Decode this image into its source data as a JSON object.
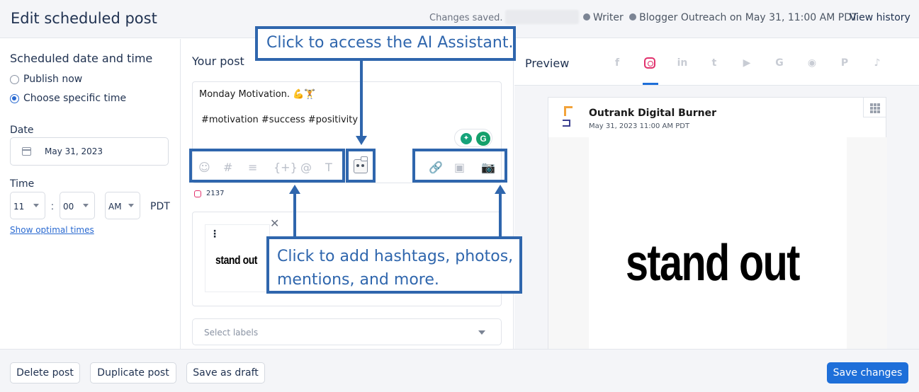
{
  "header": {
    "title": "Edit scheduled post",
    "changes_saved": "Changes saved.",
    "meta_suffix_1": "Writer",
    "meta_suffix_2": "Blogger Outreach on May 31, 11:00 AM PDT",
    "view_history": "View history"
  },
  "schedule": {
    "title": "Scheduled date and time",
    "options": [
      "Publish now",
      "Choose specific time"
    ],
    "selected": "Choose specific time",
    "date_label": "Date",
    "date_value": "May 31, 2023",
    "time_label": "Time",
    "hour": "11",
    "minute": "00",
    "ampm": "AM",
    "timezone": "PDT",
    "optimal_link": "Show optimal times"
  },
  "post": {
    "title": "Your post",
    "line1": "Monday Motivation. 💪🏋",
    "line2": "#motivation #success #positivity",
    "toolbar_left": [
      "emoji-icon",
      "hashtag-icon",
      "text-block-icon",
      "variable-icon",
      "mention-icon",
      "text-format-icon"
    ],
    "toolbar_left_glyphs": [
      "☺",
      "#",
      "≡",
      "{+}",
      "@",
      "T"
    ],
    "toolbar_right": [
      "link-icon",
      "video-icon",
      "camera-icon"
    ],
    "toolbar_right_glyphs": [
      "🔗",
      "▣",
      "📷"
    ],
    "char_count": "2137",
    "media_text": "stand out",
    "labels_placeholder": "Select labels"
  },
  "preview": {
    "title": "Preview",
    "networks": [
      "facebook",
      "instagram",
      "linkedin",
      "twitter",
      "youtube",
      "google",
      "reddit",
      "pinterest",
      "tiktok"
    ],
    "network_glyphs": [
      "f",
      "",
      "in",
      "t",
      "▶",
      "G",
      "◉",
      "P",
      "♪"
    ],
    "active_network": "instagram",
    "account_name": "Outrank Digital Burner",
    "post_date": "May 31, 2023 11:00 AM PDT",
    "image_text": "stand out"
  },
  "footer": {
    "delete": "Delete post",
    "duplicate": "Duplicate post",
    "draft": "Save as draft",
    "save": "Save changes"
  },
  "annotations": {
    "ai_assistant": "Click to access the AI Assistant.",
    "add_more_line1": "Click to add hashtags, photos,",
    "add_more_line2": "mentions, and more."
  },
  "colors": {
    "accent": "#1e6fd9",
    "annotation": "#2f66ad",
    "instagram": "#e1306c"
  }
}
